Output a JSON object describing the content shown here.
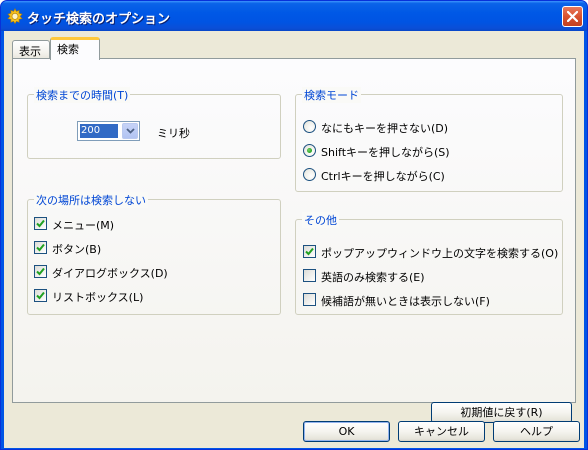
{
  "window": {
    "title": "タッチ検索のオプション"
  },
  "tabs": [
    {
      "label": "表示"
    },
    {
      "label": "検索"
    }
  ],
  "search_time": {
    "legend": "検索までの時間(T)",
    "value": "200",
    "unit": "ミリ秒"
  },
  "exclusions": {
    "legend": "次の場所は検索しない",
    "items": [
      {
        "label": "メニュー(M)",
        "checked": true
      },
      {
        "label": "ボタン(B)",
        "checked": true
      },
      {
        "label": "ダイアログボックス(D)",
        "checked": true
      },
      {
        "label": "リストボックス(L)",
        "checked": true
      }
    ]
  },
  "search_mode": {
    "legend": "検索モード",
    "options": [
      {
        "label": "なにもキーを押さない(D)",
        "selected": false
      },
      {
        "label": "Shiftキーを押しながら(S)",
        "selected": true
      },
      {
        "label": "Ctrlキーを押しながら(C)",
        "selected": false
      }
    ]
  },
  "other": {
    "legend": "その他",
    "items": [
      {
        "label": "ポップアップウィンドウ上の文字を検索する(O)",
        "checked": true
      },
      {
        "label": "英語のみ検索する(E)",
        "checked": false
      },
      {
        "label": "候補語が無いときは表示しない(F)",
        "checked": false
      }
    ]
  },
  "buttons": {
    "reset": "初期値に戻す(R)",
    "ok": "OK",
    "cancel": "キャンセル",
    "help": "ヘルプ"
  },
  "colors": {
    "titlebar": "#0054e3",
    "group_legend": "#0046d5",
    "dialog_bg": "#ece9d8",
    "check_mark": "#21a121"
  },
  "icons": {
    "app": "gear-sun-icon",
    "close": "close-icon",
    "combo": "chevron-down-icon",
    "checkbox": "check-icon"
  }
}
